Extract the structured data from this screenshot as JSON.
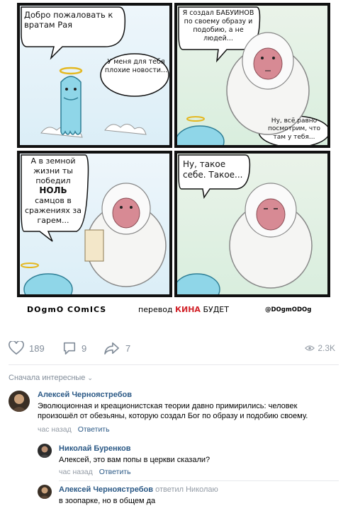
{
  "comic": {
    "panel1": {
      "speech_god": "Добро пожаловать к вратам Рая",
      "speech_news": "У меня для тебя плохие новости..."
    },
    "panel2": {
      "speech_baboon": "Я создал БАБУИНОВ по своему образу и подобию, а не людей...",
      "speech_look": "Ну, всё равно посмотрим, что там у тебя..."
    },
    "panel3": {
      "speech_line1": "А в земной жизни ты победил",
      "speech_zero": "НОЛЬ",
      "speech_line2": "самцов в сражениях за гарем..."
    },
    "panel4": {
      "speech_such": "Ну, такое себе. Такое..."
    },
    "credits": {
      "author": "DOgmO COmICS",
      "translation_prefix": "перевод",
      "translation_red": "КИНА",
      "translation_suffix": "БУДЕТ",
      "handle": "@DOgmODOg"
    }
  },
  "actions": {
    "likes": "189",
    "comments": "9",
    "shares": "7",
    "views": "2.3K"
  },
  "comments_header": {
    "sort_label": "Сначала интересные"
  },
  "comments": [
    {
      "author": "Алексей Черноястребов",
      "reply_to": "",
      "text": "Эволюционная и креационистская теории давно примирились: человек произошёл от обезьяны, которую создал Бог по образу и подобию своему.",
      "time": "час назад",
      "reply_label": "Ответить"
    },
    {
      "author": "Николай Буренков",
      "reply_to": "",
      "text": "Алексей, это вам попы в церкви сказали?",
      "time": "час назад",
      "reply_label": "Ответить"
    },
    {
      "author": "Алексей Черноястребов",
      "reply_to": "ответил Николаю",
      "text": "в зоопарке, но в общем да",
      "time": "",
      "reply_label": ""
    }
  ],
  "colors": {
    "link_blue": "#2a5885",
    "meta_gray": "#939ba5",
    "accent_red": "#d2232a"
  }
}
